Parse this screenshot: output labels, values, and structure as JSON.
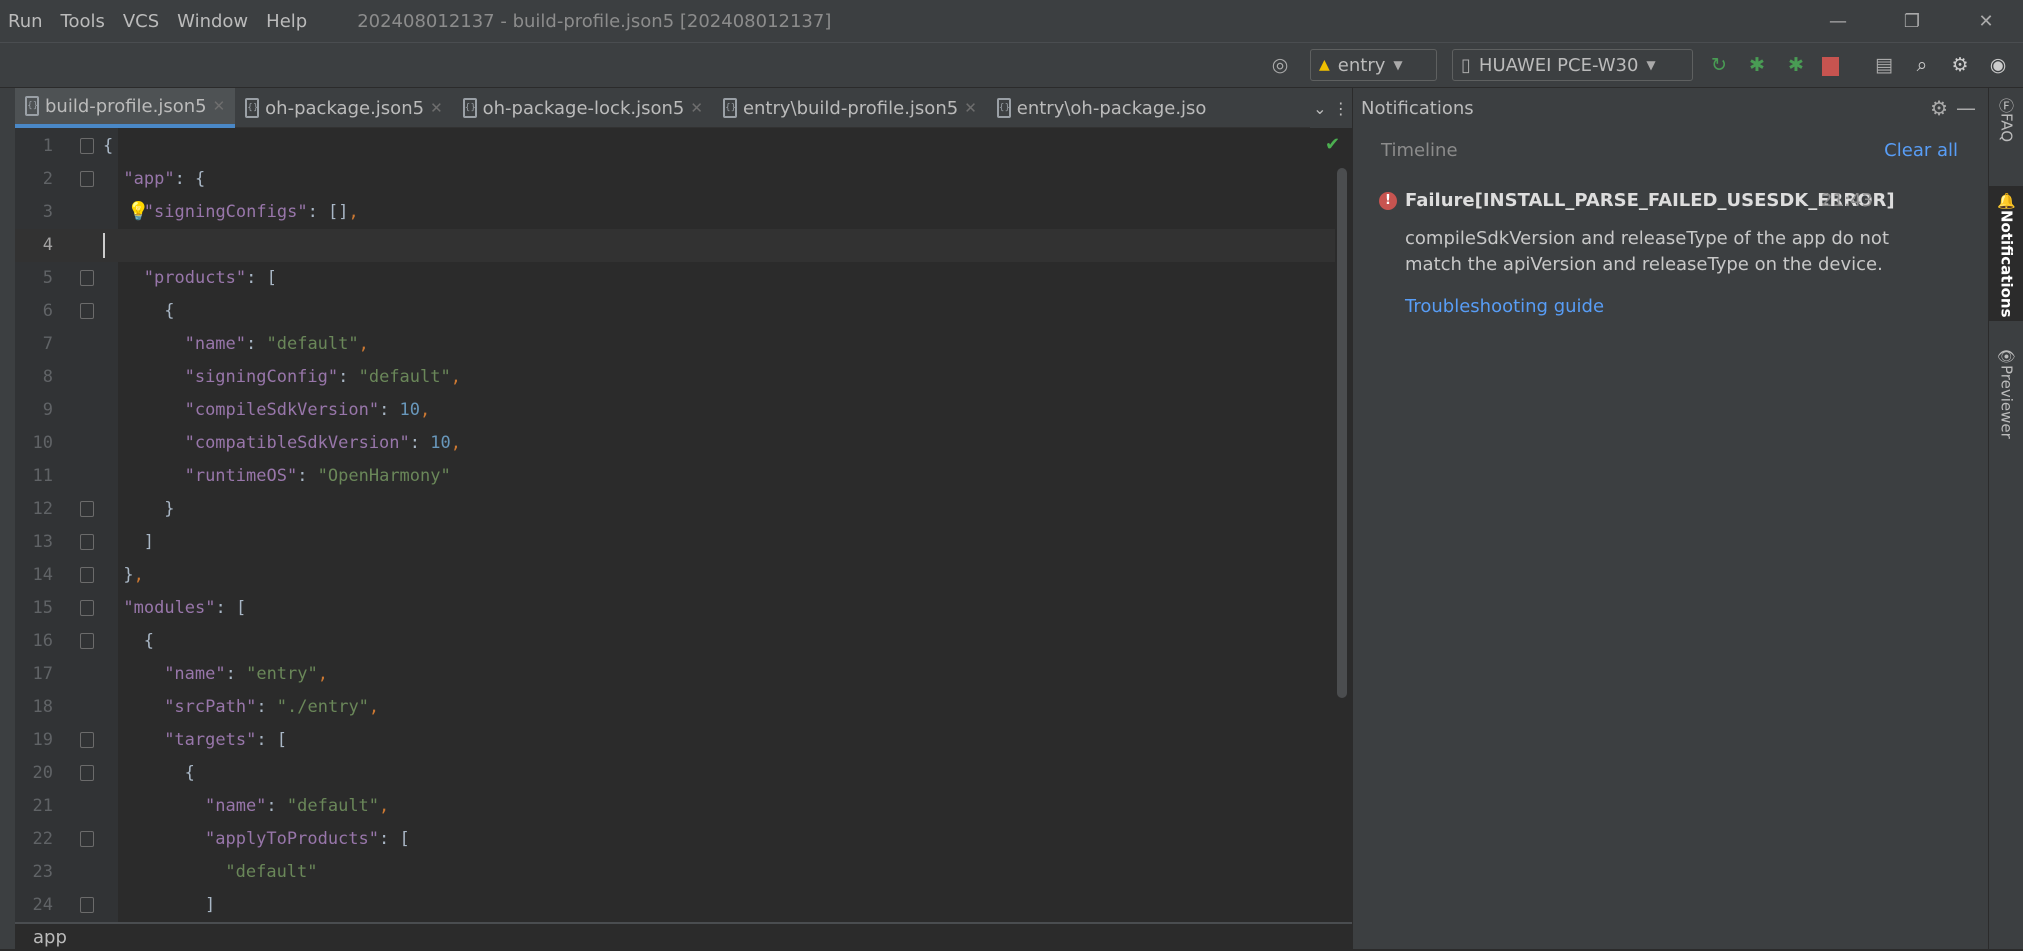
{
  "menu": [
    "Run",
    "Tools",
    "VCS",
    "Window",
    "Help"
  ],
  "window_title": "202408012137 - build-profile.json5 [202408012137]",
  "window_controls": {
    "minimize": "—",
    "restore": "❐",
    "close": "✕"
  },
  "toolbar": {
    "module_select": "entry",
    "device_select": "HUAWEI PCE-W30",
    "icons": [
      "locate-icon",
      "run-icon",
      "debug-icon",
      "attach-debugger-icon",
      "stop-icon",
      "project-structure-icon",
      "search-icon",
      "settings-icon",
      "account-icon"
    ],
    "colors": {
      "run": "#499c54",
      "stop": "#c75450"
    }
  },
  "tabs": [
    {
      "label": "build-profile.json5",
      "active": true,
      "closable": true
    },
    {
      "label": "oh-package.json5",
      "active": false,
      "closable": true
    },
    {
      "label": "oh-package-lock.json5",
      "active": false,
      "closable": true
    },
    {
      "label": "entry\\build-profile.json5",
      "active": false,
      "closable": true
    },
    {
      "label": "entry\\oh-package.jso",
      "active": false,
      "closable": false
    }
  ],
  "editor": {
    "current_line": 4,
    "lines": [
      {
        "n": 1,
        "ind": 0,
        "fold": "open",
        "t": [
          [
            "p",
            "{"
          ]
        ]
      },
      {
        "n": 2,
        "ind": 2,
        "fold": "open",
        "t": [
          [
            "k",
            "\"app\""
          ],
          [
            "p",
            ": {"
          ]
        ]
      },
      {
        "n": 3,
        "ind": 4,
        "bulb": true,
        "t": [
          [
            "k",
            "\"signingConfigs\""
          ],
          [
            "p",
            ": []"
          ],
          [
            "c",
            ","
          ]
        ]
      },
      {
        "n": 4,
        "ind": 0,
        "t": []
      },
      {
        "n": 5,
        "ind": 4,
        "fold": "open",
        "t": [
          [
            "k",
            "\"products\""
          ],
          [
            "p",
            ": ["
          ]
        ]
      },
      {
        "n": 6,
        "ind": 6,
        "fold": "open",
        "t": [
          [
            "p",
            "{"
          ]
        ]
      },
      {
        "n": 7,
        "ind": 8,
        "t": [
          [
            "k",
            "\"name\""
          ],
          [
            "p",
            ": "
          ],
          [
            "s",
            "\"default\""
          ],
          [
            "c",
            ","
          ]
        ]
      },
      {
        "n": 8,
        "ind": 8,
        "t": [
          [
            "k",
            "\"signingConfig\""
          ],
          [
            "p",
            ": "
          ],
          [
            "s",
            "\"default\""
          ],
          [
            "c",
            ","
          ]
        ]
      },
      {
        "n": 9,
        "ind": 8,
        "t": [
          [
            "k",
            "\"compileSdkVersion\""
          ],
          [
            "p",
            ": "
          ],
          [
            "n",
            "10"
          ],
          [
            "c",
            ","
          ]
        ]
      },
      {
        "n": 10,
        "ind": 8,
        "t": [
          [
            "k",
            "\"compatibleSdkVersion\""
          ],
          [
            "p",
            ": "
          ],
          [
            "n",
            "10"
          ],
          [
            "c",
            ","
          ]
        ]
      },
      {
        "n": 11,
        "ind": 8,
        "t": [
          [
            "k",
            "\"runtimeOS\""
          ],
          [
            "p",
            ": "
          ],
          [
            "s",
            "\"OpenHarmony\""
          ]
        ]
      },
      {
        "n": 12,
        "ind": 6,
        "fold": "close",
        "t": [
          [
            "p",
            "}"
          ]
        ]
      },
      {
        "n": 13,
        "ind": 4,
        "fold": "close",
        "t": [
          [
            "p",
            "]"
          ]
        ]
      },
      {
        "n": 14,
        "ind": 2,
        "fold": "close",
        "t": [
          [
            "p",
            "}"
          ],
          [
            "c",
            ","
          ]
        ]
      },
      {
        "n": 15,
        "ind": 2,
        "fold": "open",
        "t": [
          [
            "k",
            "\"modules\""
          ],
          [
            "p",
            ": ["
          ]
        ]
      },
      {
        "n": 16,
        "ind": 4,
        "fold": "open",
        "t": [
          [
            "p",
            "{"
          ]
        ]
      },
      {
        "n": 17,
        "ind": 6,
        "t": [
          [
            "k",
            "\"name\""
          ],
          [
            "p",
            ": "
          ],
          [
            "s",
            "\"entry\""
          ],
          [
            "c",
            ","
          ]
        ]
      },
      {
        "n": 18,
        "ind": 6,
        "t": [
          [
            "k",
            "\"srcPath\""
          ],
          [
            "p",
            ": "
          ],
          [
            "s",
            "\"./entry\""
          ],
          [
            "c",
            ","
          ]
        ]
      },
      {
        "n": 19,
        "ind": 6,
        "fold": "open",
        "t": [
          [
            "k",
            "\"targets\""
          ],
          [
            "p",
            ": ["
          ]
        ]
      },
      {
        "n": 20,
        "ind": 8,
        "fold": "open",
        "t": [
          [
            "p",
            "{"
          ]
        ]
      },
      {
        "n": 21,
        "ind": 10,
        "t": [
          [
            "k",
            "\"name\""
          ],
          [
            "p",
            ": "
          ],
          [
            "s",
            "\"default\""
          ],
          [
            "c",
            ","
          ]
        ]
      },
      {
        "n": 22,
        "ind": 10,
        "fold": "open",
        "t": [
          [
            "k",
            "\"applyToProducts\""
          ],
          [
            "p",
            ": ["
          ]
        ]
      },
      {
        "n": 23,
        "ind": 12,
        "t": [
          [
            "s",
            "\"default\""
          ]
        ]
      },
      {
        "n": 24,
        "ind": 10,
        "fold": "close",
        "t": [
          [
            "p",
            "]"
          ]
        ]
      }
    ]
  },
  "breadcrumb": "app",
  "notifications": {
    "title": "Notifications",
    "section": "Timeline",
    "clear_all": "Clear all",
    "item": {
      "title": "Failure[INSTALL_PARSE_FAILED_USESDK_ERROR]",
      "time": "21:43",
      "body": "compileSdkVersion and releaseType of the app do not match the apiVersion and releaseType on the device.",
      "link": "Troubleshooting guide",
      "severity_color": "#c75450"
    }
  },
  "right_strip": [
    {
      "label": "FAQ",
      "active": false
    },
    {
      "label": "Notifications",
      "active": true
    },
    {
      "label": "Previewer",
      "active": false
    }
  ]
}
